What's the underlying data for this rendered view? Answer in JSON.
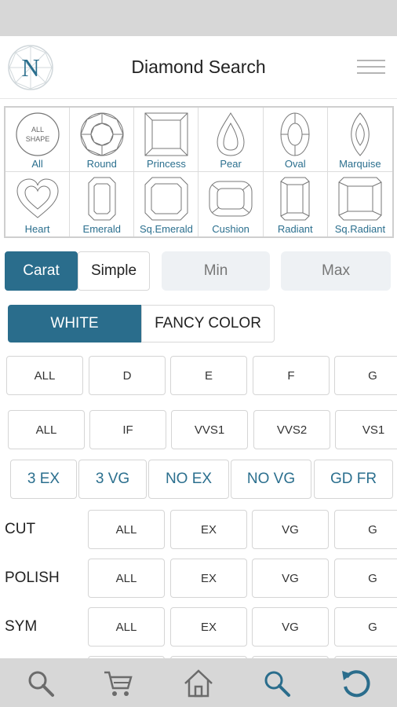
{
  "header": {
    "title": "Diamond Search",
    "logo_letter": "N"
  },
  "shapes": [
    {
      "label": "All",
      "icon": "all-shape-icon",
      "inner": [
        "ALL",
        "SHAPE"
      ]
    },
    {
      "label": "Round",
      "icon": "round-diamond-icon"
    },
    {
      "label": "Princess",
      "icon": "princess-diamond-icon"
    },
    {
      "label": "Pear",
      "icon": "pear-diamond-icon"
    },
    {
      "label": "Oval",
      "icon": "oval-diamond-icon"
    },
    {
      "label": "Marquise",
      "icon": "marquise-diamond-icon"
    },
    {
      "label": "Heart",
      "icon": "heart-diamond-icon"
    },
    {
      "label": "Emerald",
      "icon": "emerald-diamond-icon"
    },
    {
      "label": "Sq.Emerald",
      "icon": "square-emerald-diamond-icon"
    },
    {
      "label": "Cushion",
      "icon": "cushion-diamond-icon"
    },
    {
      "label": "Radiant",
      "icon": "radiant-diamond-icon"
    },
    {
      "label": "Sq.Radiant",
      "icon": "square-radiant-diamond-icon"
    }
  ],
  "carat": {
    "carat_label": "Carat",
    "simple_label": "Simple",
    "min_placeholder": "Min",
    "max_placeholder": "Max",
    "active": "Carat"
  },
  "color_type": {
    "white_label": "WHITE",
    "fancy_label": "FANCY COLOR",
    "active": "WHITE"
  },
  "colors": [
    "ALL",
    "D",
    "E",
    "F",
    "G"
  ],
  "clarity": [
    "ALL",
    "IF",
    "VVS1",
    "VVS2",
    "VS1"
  ],
  "presets": [
    "3 EX",
    "3 VG",
    "NO EX",
    "NO VG",
    "GD FR"
  ],
  "cut": {
    "label": "CUT",
    "options": [
      "ALL",
      "EX",
      "VG",
      "G"
    ]
  },
  "polish": {
    "label": "POLISH",
    "options": [
      "ALL",
      "EX",
      "VG",
      "G"
    ]
  },
  "sym": {
    "label": "SYM",
    "options": [
      "ALL",
      "EX",
      "VG",
      "G"
    ]
  },
  "nav": [
    "search-icon",
    "cart-icon",
    "home-icon",
    "diamond-search-icon",
    "reset-icon"
  ],
  "colors_theme": {
    "accent": "#2a6d8c",
    "link": "#2b6f8e",
    "bar": "#d7d7d7",
    "input_bg": "#eef1f4"
  }
}
